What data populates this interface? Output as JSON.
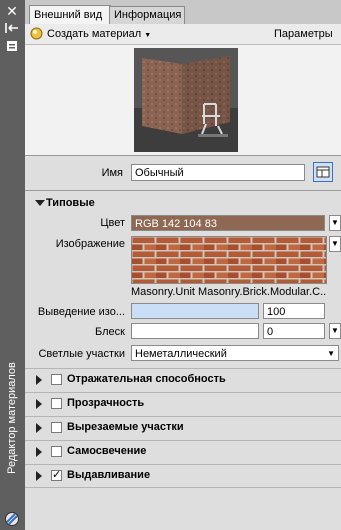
{
  "sidebar": {
    "title": "Редактор материалов"
  },
  "tabs": [
    {
      "label": "Внешний вид"
    },
    {
      "label": "Информация"
    }
  ],
  "toolbar": {
    "create_label": "Создать материал",
    "params_label": "Параметры"
  },
  "name_row": {
    "label": "Имя",
    "value": "Обычный"
  },
  "generic": {
    "title": "Типовые",
    "color_label": "Цвет",
    "color_value": "RGB 142 104 83",
    "color_hex": "#8e6853",
    "image_label": "Изображение",
    "image_caption": "Masonry.Unit Masonry.Brick.Modular.C...",
    "fade_label": "Выведение изо...",
    "fade_value": "100",
    "gloss_label": "Блеск",
    "gloss_value": "0",
    "highlights_label": "Светлые участки",
    "highlights_value": "Неметаллический"
  },
  "sections": [
    {
      "label": "Отражательная способность",
      "checked": false
    },
    {
      "label": "Прозрачность",
      "checked": false
    },
    {
      "label": "Вырезаемые участки",
      "checked": false
    },
    {
      "label": "Самосвечение",
      "checked": false
    },
    {
      "label": "Выдавливание",
      "checked": true
    }
  ]
}
